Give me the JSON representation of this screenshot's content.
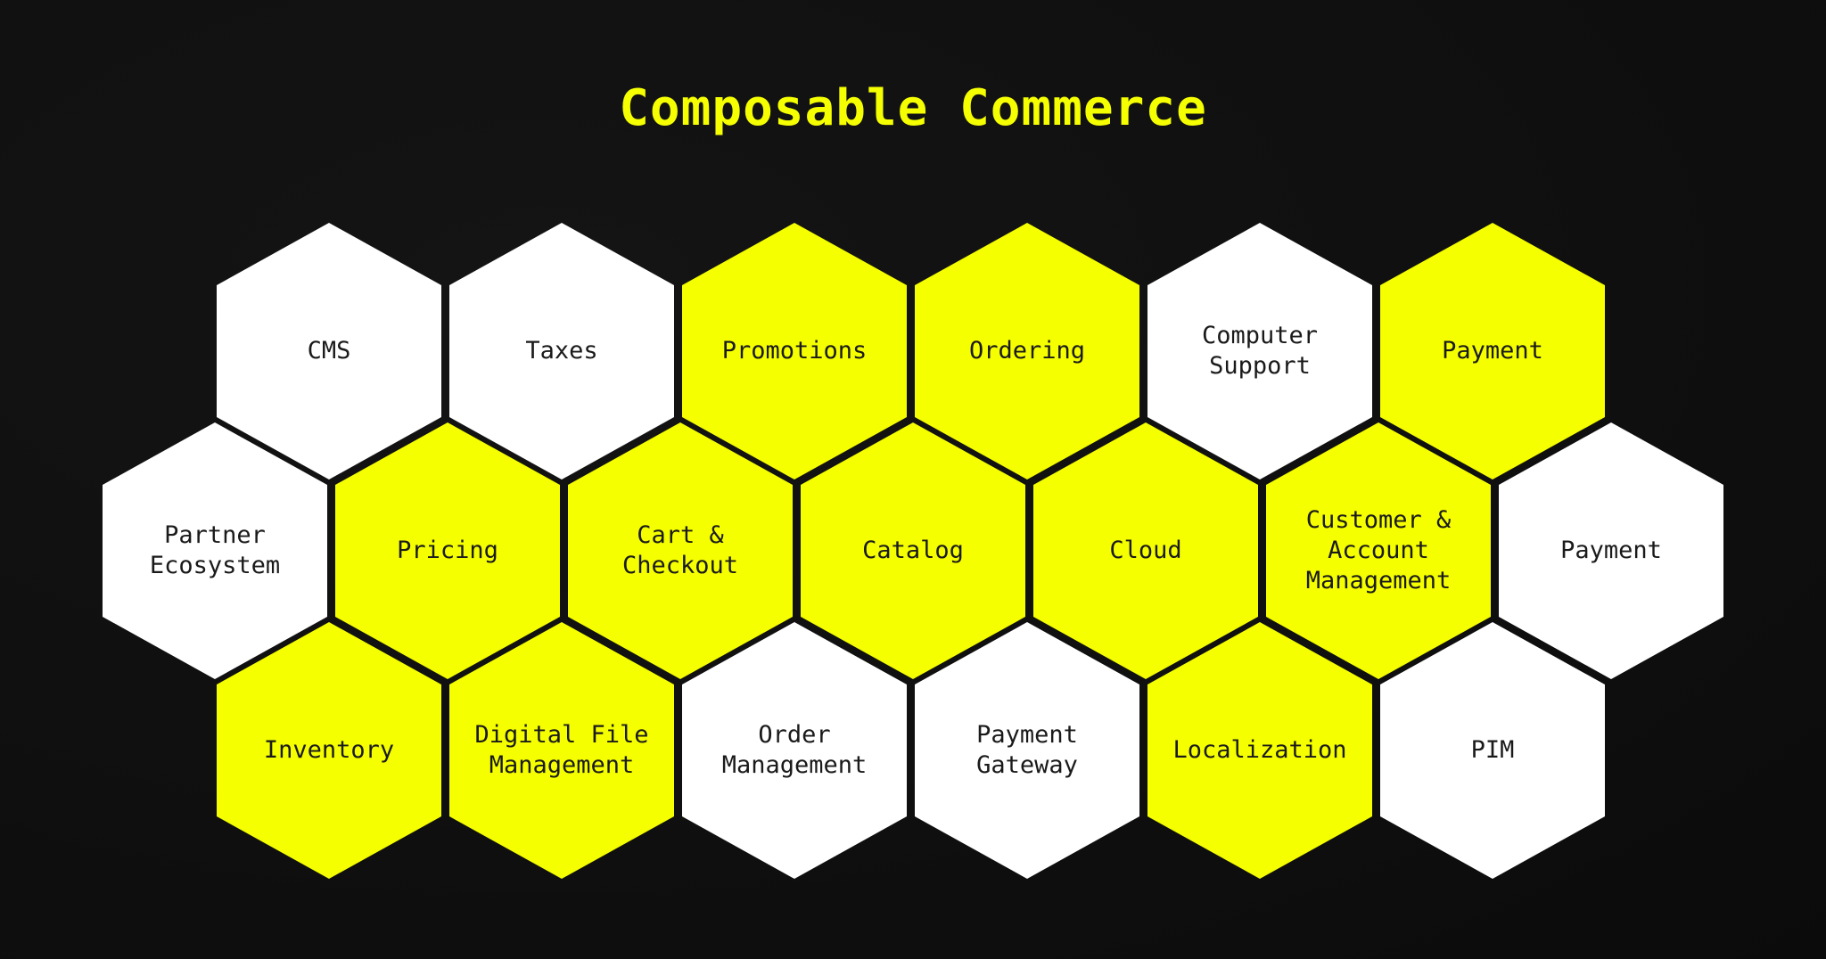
{
  "title": "Composable Commerce",
  "colors": {
    "accent": "#f5ff00",
    "tile_light": "#ffffff",
    "background": "#111111",
    "label_text": "#1a1a1a"
  },
  "rows": [
    {
      "tiles": [
        {
          "label": "CMS",
          "style": "white"
        },
        {
          "label": "Taxes",
          "style": "white"
        },
        {
          "label": "Promotions",
          "style": "yellow"
        },
        {
          "label": "Ordering",
          "style": "yellow"
        },
        {
          "label": "Computer\nSupport",
          "style": "white"
        },
        {
          "label": "Payment",
          "style": "yellow"
        }
      ]
    },
    {
      "tiles": [
        {
          "label": "Partner\nEcosystem",
          "style": "white"
        },
        {
          "label": "Pricing",
          "style": "yellow"
        },
        {
          "label": "Cart &\nCheckout",
          "style": "yellow"
        },
        {
          "label": "Catalog",
          "style": "yellow"
        },
        {
          "label": "Cloud",
          "style": "yellow"
        },
        {
          "label": "Customer &\nAccount\nManagement",
          "style": "yellow"
        },
        {
          "label": "Payment",
          "style": "white"
        }
      ]
    },
    {
      "tiles": [
        {
          "label": "Inventory",
          "style": "yellow"
        },
        {
          "label": "Digital File\nManagement",
          "style": "yellow"
        },
        {
          "label": "Order\nManagement",
          "style": "white"
        },
        {
          "label": "Payment\nGateway",
          "style": "white"
        },
        {
          "label": "Localization",
          "style": "yellow"
        },
        {
          "label": "PIM",
          "style": "white"
        }
      ]
    }
  ]
}
